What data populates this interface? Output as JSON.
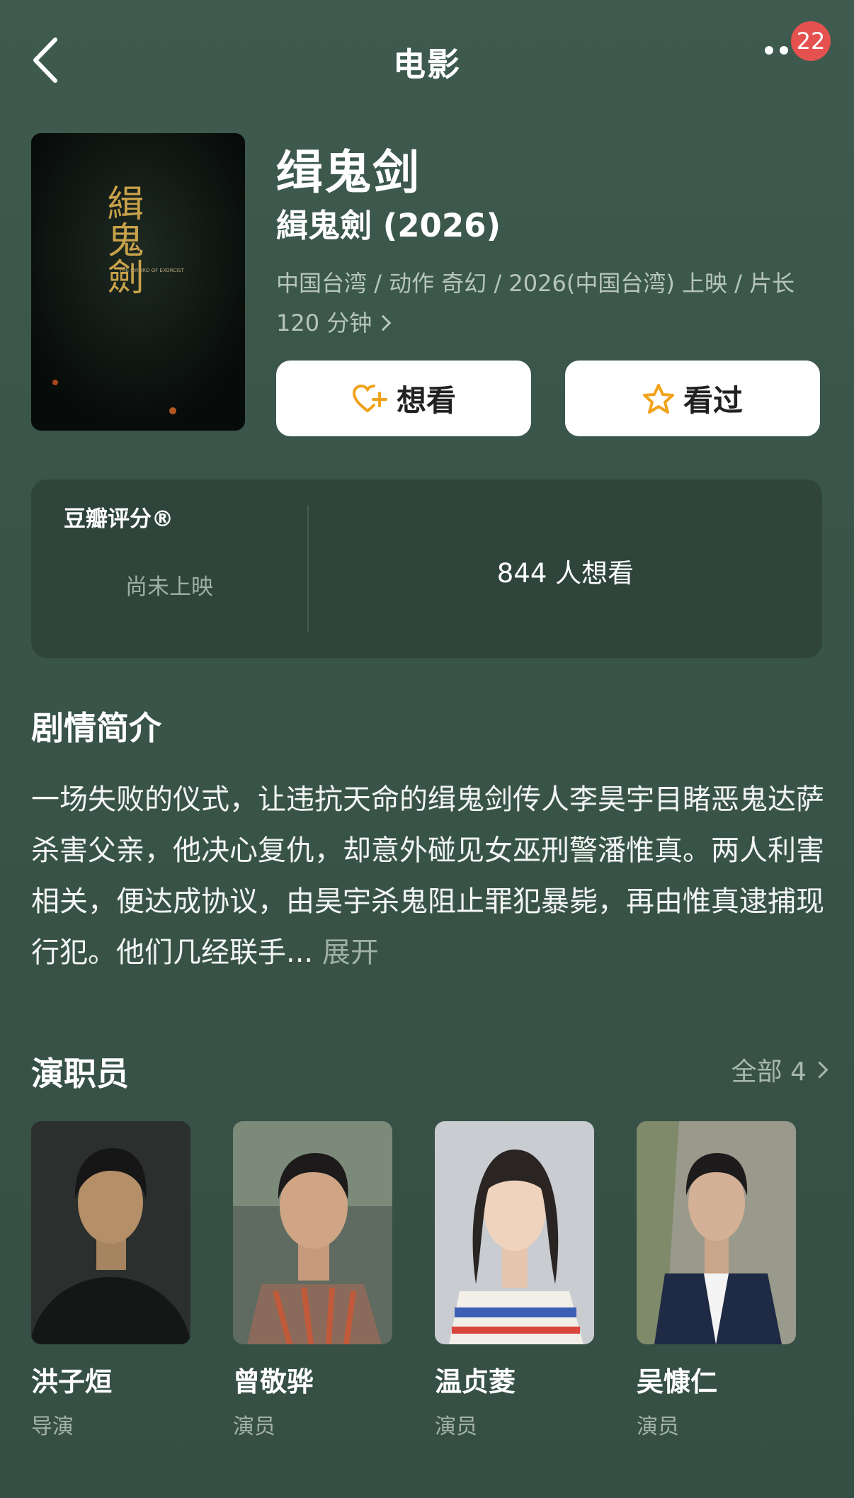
{
  "header": {
    "title": "电影",
    "notification_count": "22"
  },
  "movie": {
    "title": "缉鬼剑",
    "original_title": "緝鬼劍 (2026)",
    "meta": "中国台湾 / 动作 奇幻 / 2026(中国台湾) 上映 / 片长 120 分钟",
    "poster_text": "緝鬼劍",
    "poster_sub": "THE SWORD OF EXORCIST"
  },
  "actions": {
    "want_label": "想看",
    "seen_label": "看过"
  },
  "rating": {
    "label": "豆瓣评分®",
    "status": "尚未上映",
    "wish_count": "844 人想看"
  },
  "synopsis": {
    "title": "剧情简介",
    "text": "一场失败的仪式，让违抗天命的缉鬼剑传人李昊宇目睹恶鬼达萨杀害父亲，他决心复仇，却意外碰见女巫刑警潘惟真。两人利害相关，便达成协议，由昊宇杀鬼阻止罪犯暴毙，再由惟真逮捕现行犯。他们几经联手...",
    "expand_label": "展开"
  },
  "cast": {
    "title": "演职员",
    "all_label": "全部 4",
    "members": [
      {
        "name": "洪子烜",
        "role": "导演"
      },
      {
        "name": "曾敬骅",
        "role": "演员"
      },
      {
        "name": "温贞菱",
        "role": "演员"
      },
      {
        "name": "吴慷仁",
        "role": "演员"
      }
    ]
  },
  "colors": {
    "background": "#3a5549",
    "card": "#2f453c",
    "accent": "#f0a21a",
    "badge": "#e4514e"
  }
}
